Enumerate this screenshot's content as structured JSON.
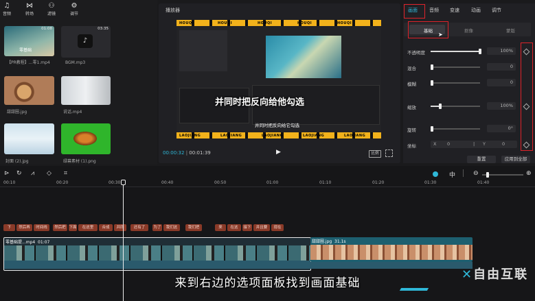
{
  "toolbar": {
    "items": [
      {
        "label": "音频",
        "icon": "music-icon"
      },
      {
        "label": "转场",
        "icon": "transition-icon"
      },
      {
        "label": "滤镜",
        "icon": "filter-icon"
      },
      {
        "label": "调节",
        "icon": "adjust-icon"
      }
    ]
  },
  "media": {
    "items": [
      {
        "label": "【PR教程】...零1.mp4",
        "duration": "01:08"
      },
      {
        "label": "BGM.mp3",
        "duration": "03:35"
      },
      {
        "label": "甜甜圈.jpg",
        "duration": ""
      },
      {
        "label": "说话.mp4",
        "duration": ""
      },
      {
        "label": "封面 (2).jpg",
        "duration": ""
      },
      {
        "label": "绿幕素材 (1).png",
        "duration": ""
      }
    ],
    "overlay_text": "零基础"
  },
  "player": {
    "title": "播放器",
    "current_time": "00:00:32",
    "total_time": "00:01:39",
    "ratio_label": "比例",
    "stripe_text": "HOUQI",
    "stripe_bottom_text": "LAOJIANG",
    "overlay_big": "并同时把反向给他勾选",
    "overlay_small": "并同时把反向给它勾选"
  },
  "inspector": {
    "tabs": [
      "画面",
      "音频",
      "变速",
      "动画",
      "调节"
    ],
    "active_tab": "画面",
    "subtabs": [
      "基础",
      "抠像",
      "蒙版"
    ],
    "active_subtab": "基础",
    "rows": [
      {
        "label": "不透明度",
        "value": "100%",
        "level": 1.0
      },
      {
        "label": "混合",
        "value": "0",
        "level": 0.0
      },
      {
        "label": "模糊",
        "value": "0",
        "level": 0.0
      },
      {
        "label": "缩放",
        "value": "100%",
        "level": 0.2
      },
      {
        "label": "旋转",
        "value": "0°",
        "level": 0.0
      }
    ],
    "position_label": "坐标",
    "x_label": "X",
    "x_value": "0",
    "y_label": "Y",
    "y_value": "0",
    "reset_label": "重置",
    "apply_all_label": "应用到全部"
  },
  "timeline": {
    "ticks": [
      "00:10",
      "00:20",
      "00:30",
      "00:40",
      "00:50",
      "01:00",
      "01:10",
      "01:20",
      "01:30",
      "01:40"
    ],
    "subtitles": [
      "下",
      "然后再",
      "时间线",
      "然后把",
      "下面",
      "在这里",
      "合成",
      "并同",
      "还有了",
      "为了",
      "我们这",
      "我们把",
      "来",
      "在这",
      "接下",
      "并且要",
      "现在"
    ],
    "clip1_label": "零基础提...mp4",
    "clip1_duration": "01:07",
    "clip2_label": "甜甜圈.jpg",
    "clip2_duration": "31.1s"
  },
  "caption": "来到右边的选项面板找到画面基础",
  "watermark": "自由互联",
  "colors": {
    "accent_red": "#e0232a",
    "accent_cyan": "#2fb8d8",
    "subtitle_clip": "#8a3a28",
    "stripe_yellow": "#f2b21b"
  }
}
